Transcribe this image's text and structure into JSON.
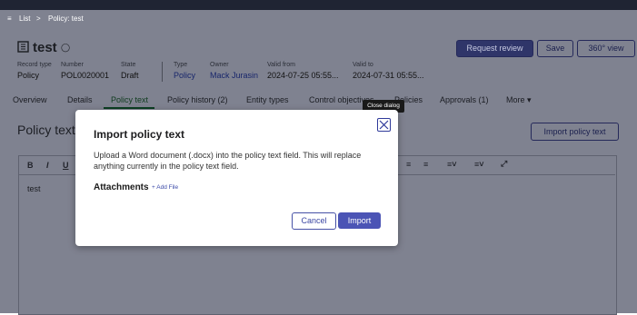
{
  "breadcrumb": {
    "list": "List",
    "sep": ">",
    "current": "Policy: test"
  },
  "header": {
    "title": "test",
    "buttons": {
      "request_review": "Request review",
      "save": "Save",
      "view360": "360° view"
    },
    "meta": [
      {
        "label": "Record type",
        "value": "Policy"
      },
      {
        "label": "Number",
        "value": "POL0020001"
      },
      {
        "label": "State",
        "value": "Draft"
      },
      {
        "label": "Type",
        "value": "Policy"
      },
      {
        "label": "Owner",
        "value": "Mack Jurasin"
      },
      {
        "label": "Valid from",
        "value": "2024-07-25 05:55..."
      },
      {
        "label": "Valid to",
        "value": "2024-07-31 05:55..."
      }
    ]
  },
  "tabs": [
    "Overview",
    "Details",
    "Policy text",
    "Policy history (2)",
    "Entity types",
    "Control objectives",
    "Policies",
    "Approvals (1)",
    "More ▾"
  ],
  "content": {
    "section_title": "Policy text",
    "import_button": "Import policy text",
    "editor_text": "test"
  },
  "tooltip": "Close dialog",
  "modal": {
    "title": "Import policy text",
    "description": "Upload a Word document (.docx) into the policy text field. This will replace anything currently in the policy text field.",
    "attachments_label": "Attachments",
    "add_file": "+ Add File",
    "cancel": "Cancel",
    "import": "Import"
  },
  "colors": {
    "accent": "#4b54b5",
    "overlay": "#7f8290"
  }
}
